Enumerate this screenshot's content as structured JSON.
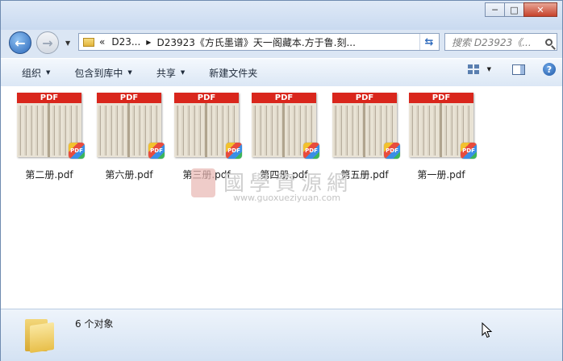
{
  "window": {
    "controls": {
      "minimize": "─",
      "maximize": "□",
      "close": "✕"
    }
  },
  "nav": {
    "breadcrumb_prefix": "«",
    "crumbs": [
      "D23...",
      "D23923《方氏墨谱》天一阁藏本.方于鲁.刻..."
    ],
    "search_placeholder": "搜索 D23923《...",
    "refresh_glyph": "⇆"
  },
  "toolbar": {
    "organize": "组织",
    "include_in_library": "包含到库中",
    "share": "共享",
    "new_folder": "新建文件夹",
    "help": "?"
  },
  "files": [
    {
      "name": "第二册.pdf",
      "badge": "PDF"
    },
    {
      "name": "第六册.pdf",
      "badge": "PDF"
    },
    {
      "name": "第三册.pdf",
      "badge": "PDF"
    },
    {
      "name": "第四册.pdf",
      "badge": "PDF"
    },
    {
      "name": "第五册.pdf",
      "badge": "PDF"
    },
    {
      "name": "第一册.pdf",
      "badge": "PDF"
    }
  ],
  "watermark": {
    "text": "國學資源網",
    "url": "www.guoxueziyuan.com"
  },
  "status": {
    "count_text": "6 个对象"
  }
}
